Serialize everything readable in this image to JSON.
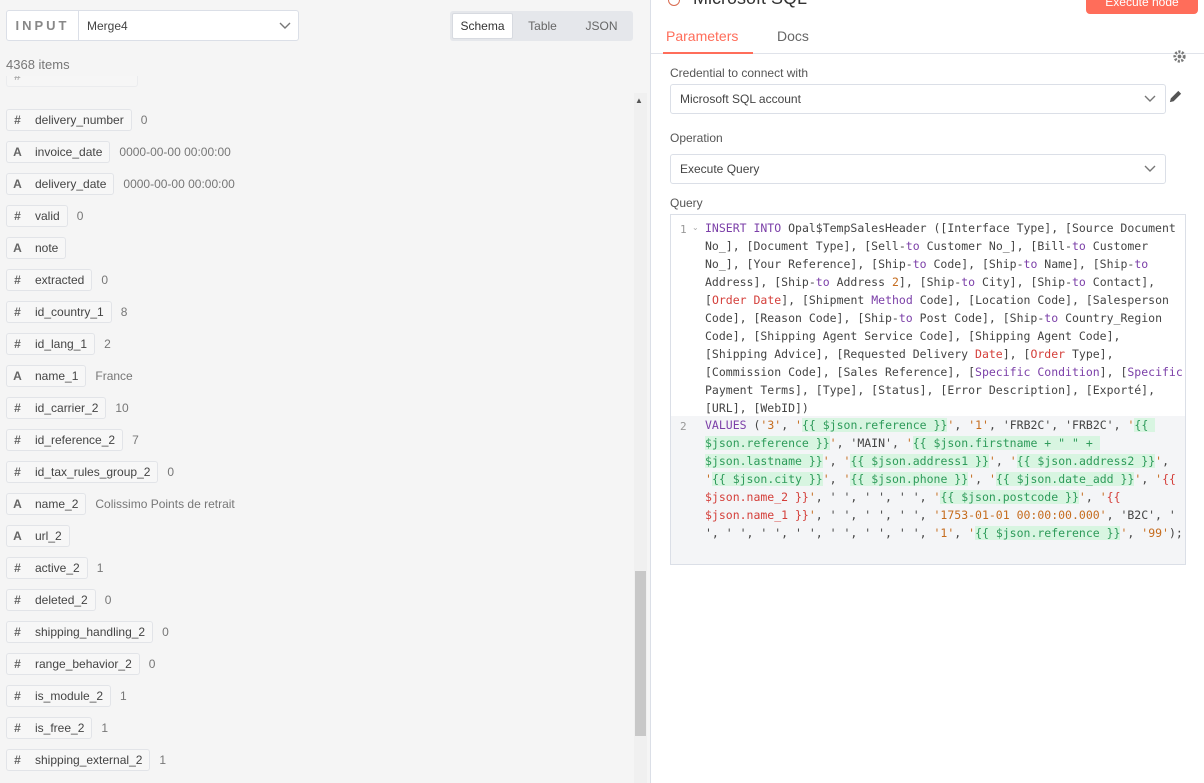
{
  "input_panel": {
    "label": "INPUT",
    "node": "Merge4",
    "views": [
      "Schema",
      "Table",
      "JSON"
    ],
    "active_view": "Schema",
    "items_count": "4368 items",
    "rows": [
      {
        "type": "#",
        "key": "delivery_number",
        "value": "0",
        "highlight": false
      },
      {
        "type": "A",
        "key": "invoice_date",
        "value": "0000-00-00 00:00:00",
        "highlight": false
      },
      {
        "type": "A",
        "key": "delivery_date",
        "value": "0000-00-00 00:00:00",
        "highlight": false
      },
      {
        "type": "#",
        "key": "valid",
        "value": "0",
        "highlight": false
      },
      {
        "type": "A",
        "key": "note",
        "value": "",
        "highlight": false
      },
      {
        "type": "#",
        "key": "extracted",
        "value": "0",
        "highlight": false
      },
      {
        "type": "#",
        "key": "id_country_1",
        "value": "8",
        "highlight": false
      },
      {
        "type": "#",
        "key": "id_lang_1",
        "value": "2",
        "highlight": false
      },
      {
        "type": "A",
        "key": "name_1",
        "value": "France",
        "highlight": true
      },
      {
        "type": "#",
        "key": "id_carrier_2",
        "value": "10",
        "highlight": false
      },
      {
        "type": "#",
        "key": "id_reference_2",
        "value": "7",
        "highlight": false
      },
      {
        "type": "#",
        "key": "id_tax_rules_group_2",
        "value": "0",
        "highlight": false
      },
      {
        "type": "A",
        "key": "name_2",
        "value": "Colissimo Points de retrait",
        "highlight": true
      },
      {
        "type": "A",
        "key": "url_2",
        "value": "",
        "highlight": false
      },
      {
        "type": "#",
        "key": "active_2",
        "value": "1",
        "highlight": false
      },
      {
        "type": "#",
        "key": "deleted_2",
        "value": "0",
        "highlight": false
      },
      {
        "type": "#",
        "key": "shipping_handling_2",
        "value": "0",
        "highlight": false
      },
      {
        "type": "#",
        "key": "range_behavior_2",
        "value": "0",
        "highlight": false
      },
      {
        "type": "#",
        "key": "is_module_2",
        "value": "1",
        "highlight": false
      },
      {
        "type": "#",
        "key": "is_free_2",
        "value": "1",
        "highlight": false
      },
      {
        "type": "#",
        "key": "shipping_external_2",
        "value": "1",
        "highlight": false
      }
    ]
  },
  "node_panel": {
    "title": "Microsoft SQL",
    "execute_label": "Execute node",
    "tabs": [
      "Parameters",
      "Docs"
    ],
    "credential_label": "Credential to connect with",
    "credential_value": "Microsoft SQL account",
    "operation_label": "Operation",
    "operation_value": "Execute Query",
    "query_label": "Query",
    "line_numbers": [
      "1",
      "2"
    ]
  },
  "colors": {
    "accent": "#ff6d5a",
    "highlight": "#f7f000",
    "expression_bg": "#d8f5e1"
  }
}
